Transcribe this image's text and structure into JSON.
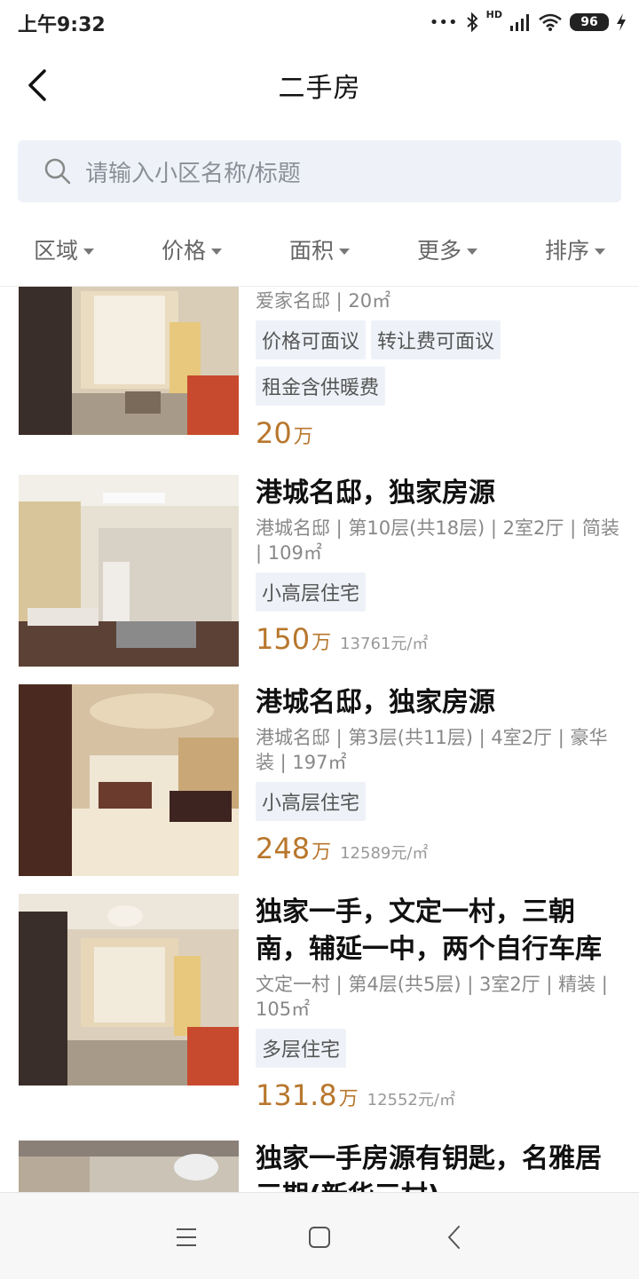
{
  "status": {
    "time": "上午9:32",
    "battery": "96",
    "network": "HD"
  },
  "header": {
    "title": "二手房"
  },
  "search": {
    "placeholder": "请输入小区名称/标题"
  },
  "filters": [
    "区域",
    "价格",
    "面积",
    "更多",
    "排序"
  ],
  "listings": [
    {
      "title": "",
      "meta": "爱家名邸 | 20㎡",
      "tags": [
        "价格可面议",
        "转让费可面议",
        "租金含供暖费"
      ],
      "price": "20",
      "price_unit": "万",
      "price_per_m2": ""
    },
    {
      "title": "港城名邸，独家房源",
      "meta": "港城名邸 | 第10层(共18层) | 2室2厅 | 简装 | 109㎡",
      "tags": [
        "小高层住宅"
      ],
      "price": "150",
      "price_unit": "万",
      "price_per_m2": "13761元/㎡"
    },
    {
      "title": "港城名邸，独家房源",
      "meta": "港城名邸 | 第3层(共11层) | 4室2厅 | 豪华装 | 197㎡",
      "tags": [
        "小高层住宅"
      ],
      "price": "248",
      "price_unit": "万",
      "price_per_m2": "12589元/㎡"
    },
    {
      "title": "独家一手，文定一村，三朝南，辅延一中，两个自行车库",
      "meta": "文定一村 | 第4层(共5层) | 3室2厅 | 精装 | 105㎡",
      "tags": [
        "多层住宅"
      ],
      "price": "131.8",
      "price_unit": "万",
      "price_per_m2": "12552元/㎡"
    },
    {
      "title": "独家一手房源有钥匙，名雅居三期(新华三村)",
      "meta": "",
      "tags": [],
      "price": "",
      "price_unit": "",
      "price_per_m2": ""
    }
  ],
  "icons": {
    "back": "chevron-left-icon",
    "search": "search-icon",
    "menu": "menu-icon",
    "home": "home-square-icon",
    "nav_back": "nav-back-icon"
  },
  "colors": {
    "price": "#b8772d",
    "tag_bg": "#eef2f8",
    "search_bg": "#eef2f8"
  }
}
